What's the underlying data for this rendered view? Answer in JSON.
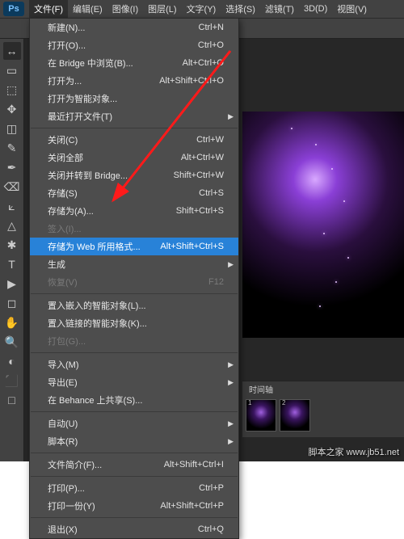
{
  "watermark": "脚本之家 www.jb51.net",
  "menubar": {
    "items": [
      {
        "label": "文件(F)",
        "active": true
      },
      {
        "label": "编辑(E)"
      },
      {
        "label": "图像(I)"
      },
      {
        "label": "图层(L)"
      },
      {
        "label": "文字(Y)"
      },
      {
        "label": "选择(S)"
      },
      {
        "label": "滤镜(T)"
      },
      {
        "label": "3D(D)"
      },
      {
        "label": "视图(V)"
      }
    ]
  },
  "timeline": {
    "label": "时间轴",
    "frames": [
      {
        "n": "1"
      },
      {
        "n": "2"
      }
    ]
  },
  "menu": {
    "groups": [
      [
        {
          "label": "新建(N)...",
          "shortcut": "Ctrl+N"
        },
        {
          "label": "打开(O)...",
          "shortcut": "Ctrl+O"
        },
        {
          "label": "在 Bridge 中浏览(B)...",
          "shortcut": "Alt+Ctrl+O"
        },
        {
          "label": "打开为...",
          "shortcut": "Alt+Shift+Ctrl+O"
        },
        {
          "label": "打开为智能对象...",
          "shortcut": ""
        },
        {
          "label": "最近打开文件(T)",
          "shortcut": "",
          "sub": true
        }
      ],
      [
        {
          "label": "关闭(C)",
          "shortcut": "Ctrl+W"
        },
        {
          "label": "关闭全部",
          "shortcut": "Alt+Ctrl+W"
        },
        {
          "label": "关闭并转到 Bridge...",
          "shortcut": "Shift+Ctrl+W"
        },
        {
          "label": "存储(S)",
          "shortcut": "Ctrl+S"
        },
        {
          "label": "存储为(A)...",
          "shortcut": "Shift+Ctrl+S"
        },
        {
          "label": "签入(I)...",
          "shortcut": "",
          "disabled": true
        },
        {
          "label": "存储为 Web 所用格式...",
          "shortcut": "Alt+Shift+Ctrl+S",
          "hot": true
        },
        {
          "label": "生成",
          "shortcut": "",
          "sub": true
        },
        {
          "label": "恢复(V)",
          "shortcut": "F12",
          "disabled": true
        }
      ],
      [
        {
          "label": "置入嵌入的智能对象(L)...",
          "shortcut": ""
        },
        {
          "label": "置入链接的智能对象(K)...",
          "shortcut": ""
        },
        {
          "label": "打包(G)...",
          "shortcut": "",
          "disabled": true
        }
      ],
      [
        {
          "label": "导入(M)",
          "shortcut": "",
          "sub": true
        },
        {
          "label": "导出(E)",
          "shortcut": "",
          "sub": true
        },
        {
          "label": "在 Behance 上共享(S)...",
          "shortcut": ""
        }
      ],
      [
        {
          "label": "自动(U)",
          "shortcut": "",
          "sub": true
        },
        {
          "label": "脚本(R)",
          "shortcut": "",
          "sub": true
        }
      ],
      [
        {
          "label": "文件简介(F)...",
          "shortcut": "Alt+Shift+Ctrl+I"
        }
      ],
      [
        {
          "label": "打印(P)...",
          "shortcut": "Ctrl+P"
        },
        {
          "label": "打印一份(Y)",
          "shortcut": "Alt+Shift+Ctrl+P"
        }
      ],
      [
        {
          "label": "退出(X)",
          "shortcut": "Ctrl+Q"
        }
      ]
    ]
  },
  "tools": [
    "↔",
    "▭",
    "⬚",
    "✥",
    "◫",
    "✎",
    "✒",
    "⌫",
    "⟀",
    "△",
    "✱",
    "T",
    "▶",
    "◻",
    "✋",
    "🔍",
    "◐",
    "⬛",
    "□"
  ]
}
